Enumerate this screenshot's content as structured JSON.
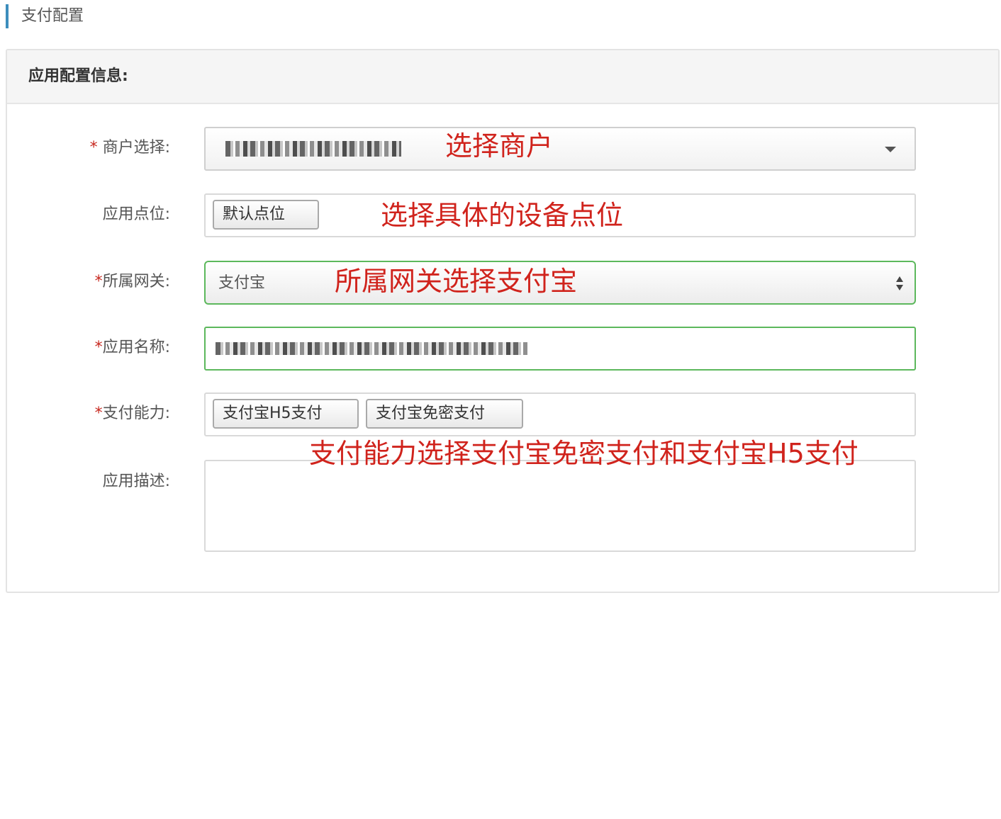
{
  "page_title": "支付配置",
  "panel": {
    "heading": "应用配置信息:"
  },
  "form": {
    "required_mark": "*",
    "merchant": {
      "label": "商户选择:"
    },
    "point": {
      "label": "应用点位:",
      "tags": [
        "默认点位"
      ]
    },
    "gateway": {
      "label": "所属网关:",
      "value": "支付宝"
    },
    "app_name": {
      "label": "应用名称:"
    },
    "capability": {
      "label": "支付能力:",
      "tags": [
        "支付宝H5支付",
        "支付宝免密支付"
      ]
    },
    "description": {
      "label": "应用描述:",
      "value": ""
    }
  },
  "annotations": {
    "merchant": "选择商户",
    "point": "选择具体的设备点位",
    "gateway": "所属网关选择支付宝",
    "capability": "支付能力选择支付宝免密支付和支付宝H5支付"
  },
  "colors": {
    "accent": "#3c8dbc",
    "annotation_red": "#d0231c",
    "focus_green": "#5cb85c"
  }
}
